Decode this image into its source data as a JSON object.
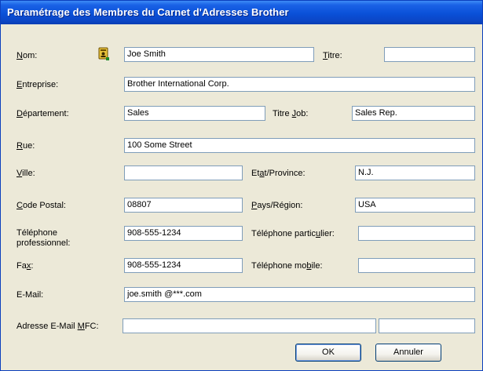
{
  "window": {
    "title": "Paramétrage des Membres du Carnet d'Adresses Brother"
  },
  "labels": {
    "nom": [
      "N",
      "om:"
    ],
    "titre": [
      "T",
      "itre:"
    ],
    "entreprise": [
      "E",
      "ntreprise:"
    ],
    "departement": [
      "D",
      "épartement:"
    ],
    "titre_job_a": "Titre ",
    "titre_job_u": "J",
    "titre_job_b": "ob:",
    "rue": [
      "R",
      "ue:"
    ],
    "ville": [
      "V",
      "ille:"
    ],
    "etat_a": "Et",
    "etat_u": "a",
    "etat_b": "t/Province:",
    "code_postal": [
      "C",
      "ode Postal:"
    ],
    "pays": [
      "P",
      "ays/Région:"
    ],
    "tel_pro_1": "Téléphone",
    "tel_pro_2": "professionnel:",
    "tel_part_a": "Téléphone partic",
    "tel_part_u": "u",
    "tel_part_b": "lier:",
    "fax_a": "Fa",
    "fax_u": "x",
    "fax_b": ":",
    "tel_mob_a": "Téléphone mo",
    "tel_mob_u": "b",
    "tel_mob_b": "ile:",
    "email": "E-Mail:",
    "email_mfc_a": "Adresse E-Mail ",
    "email_mfc_u": "M",
    "email_mfc_b": "FC:"
  },
  "fields": {
    "nom": "Joe Smith",
    "titre": "",
    "entreprise": "Brother International Corp.",
    "departement": "Sales",
    "titre_job": "Sales Rep.",
    "rue": "100 Some Street",
    "ville": "",
    "etat": "N.J.",
    "code_postal": "08807",
    "pays": "USA",
    "tel_pro": "908-555-1234",
    "tel_part": "",
    "fax": "908-555-1234",
    "tel_mob": "",
    "email": "joe.smith @***.com",
    "email_mfc_1": "",
    "email_mfc_2": ""
  },
  "buttons": {
    "ok": "OK",
    "cancel": "Annuler"
  },
  "icons": {
    "name_lookup": "address-card-icon"
  }
}
